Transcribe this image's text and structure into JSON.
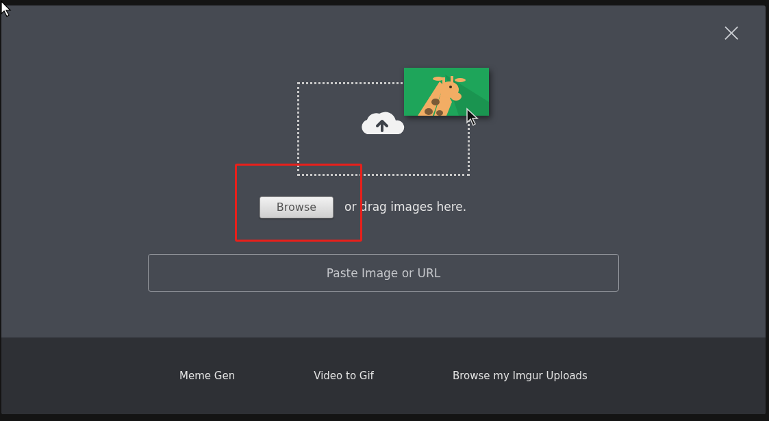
{
  "dialog": {
    "close_label": "×"
  },
  "upload": {
    "browse_button": "Browse",
    "drag_text": "or drag images here."
  },
  "paste_field": {
    "placeholder": "Paste Image or URL"
  },
  "footer_links": [
    {
      "label": "Meme Gen"
    },
    {
      "label": "Video to Gif"
    },
    {
      "label": "Browse my Imgur Uploads"
    }
  ]
}
